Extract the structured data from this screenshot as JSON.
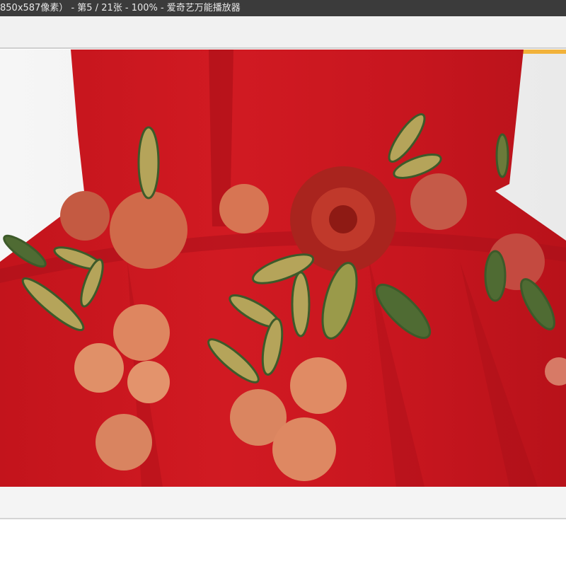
{
  "window": {
    "title": "850x587像素） - 第5 / 21张 - 100% - 爱奇艺万能播放器"
  },
  "viewer": {
    "image_description_label": "",
    "current_index": 5,
    "total": 21,
    "zoom_percent": 100
  }
}
